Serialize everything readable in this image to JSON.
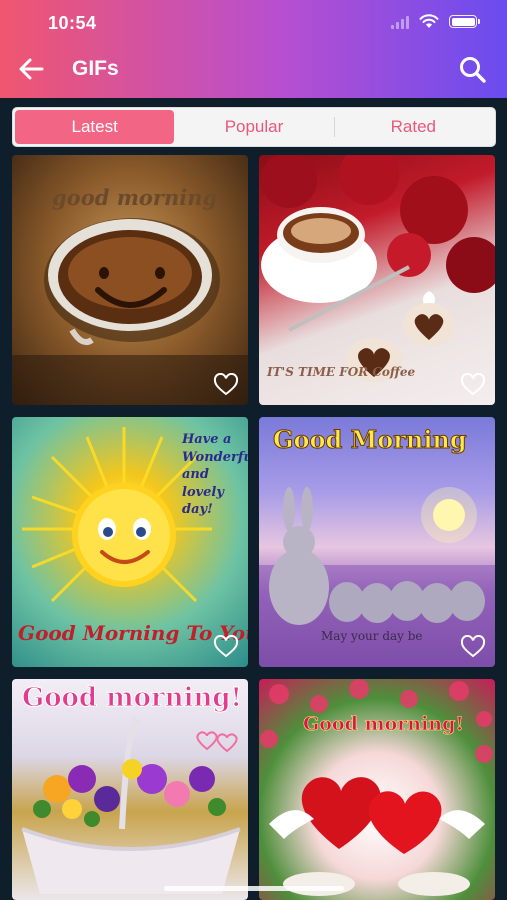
{
  "status_bar": {
    "time": "10:54"
  },
  "header": {
    "title": "GIFs"
  },
  "tabs": [
    {
      "label": "Latest",
      "active": true
    },
    {
      "label": "Popular",
      "active": false
    },
    {
      "label": "Rated",
      "active": false
    }
  ],
  "gifs": [
    {
      "caption": "good morning",
      "favorited": false
    },
    {
      "caption": "IT'S TIME FOR Coffee",
      "favorited": false
    },
    {
      "caption": "Good Morning To You",
      "caption_side": "Have a Wonderful and lovely day!",
      "favorited": false
    },
    {
      "caption": "Good Morning",
      "caption_bottom": "May your day be",
      "favorited": false
    },
    {
      "caption": "Good morning!",
      "favorited": false
    },
    {
      "caption": "Good morning!",
      "favorited": false
    }
  ],
  "colors": {
    "header_gradient_start": "#f0566f",
    "header_gradient_end": "#6a4cf0",
    "tab_active": "#f26585",
    "tab_text": "#e8597c",
    "background": "#0f1e2b"
  },
  "icons": {
    "back": "arrow-left-icon",
    "search": "search-icon",
    "favorite": "heart-outline-icon"
  }
}
